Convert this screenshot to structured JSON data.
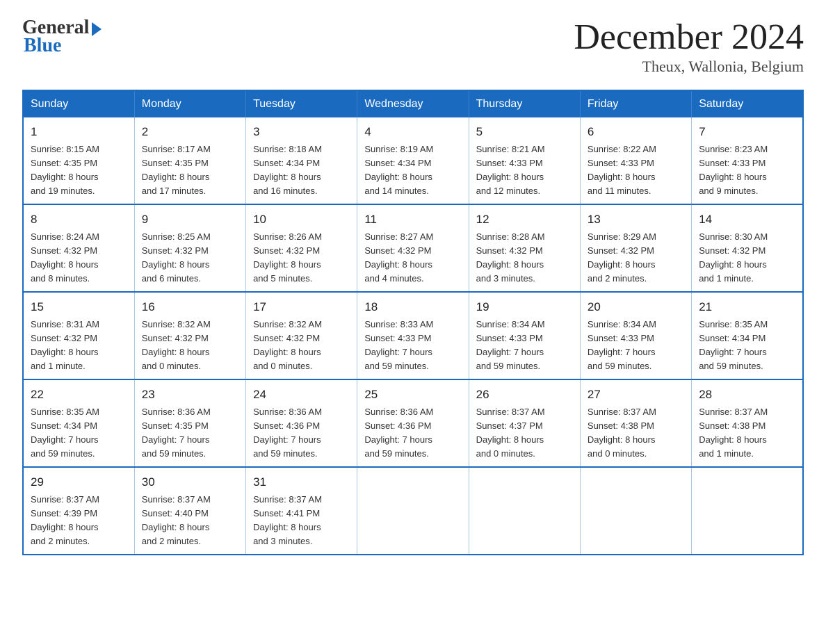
{
  "header": {
    "logo_general": "General",
    "logo_blue": "Blue",
    "month_title": "December 2024",
    "subtitle": "Theux, Wallonia, Belgium"
  },
  "days_of_week": [
    "Sunday",
    "Monday",
    "Tuesday",
    "Wednesday",
    "Thursday",
    "Friday",
    "Saturday"
  ],
  "weeks": [
    [
      {
        "day": "1",
        "info": "Sunrise: 8:15 AM\nSunset: 4:35 PM\nDaylight: 8 hours\nand 19 minutes."
      },
      {
        "day": "2",
        "info": "Sunrise: 8:17 AM\nSunset: 4:35 PM\nDaylight: 8 hours\nand 17 minutes."
      },
      {
        "day": "3",
        "info": "Sunrise: 8:18 AM\nSunset: 4:34 PM\nDaylight: 8 hours\nand 16 minutes."
      },
      {
        "day": "4",
        "info": "Sunrise: 8:19 AM\nSunset: 4:34 PM\nDaylight: 8 hours\nand 14 minutes."
      },
      {
        "day": "5",
        "info": "Sunrise: 8:21 AM\nSunset: 4:33 PM\nDaylight: 8 hours\nand 12 minutes."
      },
      {
        "day": "6",
        "info": "Sunrise: 8:22 AM\nSunset: 4:33 PM\nDaylight: 8 hours\nand 11 minutes."
      },
      {
        "day": "7",
        "info": "Sunrise: 8:23 AM\nSunset: 4:33 PM\nDaylight: 8 hours\nand 9 minutes."
      }
    ],
    [
      {
        "day": "8",
        "info": "Sunrise: 8:24 AM\nSunset: 4:32 PM\nDaylight: 8 hours\nand 8 minutes."
      },
      {
        "day": "9",
        "info": "Sunrise: 8:25 AM\nSunset: 4:32 PM\nDaylight: 8 hours\nand 6 minutes."
      },
      {
        "day": "10",
        "info": "Sunrise: 8:26 AM\nSunset: 4:32 PM\nDaylight: 8 hours\nand 5 minutes."
      },
      {
        "day": "11",
        "info": "Sunrise: 8:27 AM\nSunset: 4:32 PM\nDaylight: 8 hours\nand 4 minutes."
      },
      {
        "day": "12",
        "info": "Sunrise: 8:28 AM\nSunset: 4:32 PM\nDaylight: 8 hours\nand 3 minutes."
      },
      {
        "day": "13",
        "info": "Sunrise: 8:29 AM\nSunset: 4:32 PM\nDaylight: 8 hours\nand 2 minutes."
      },
      {
        "day": "14",
        "info": "Sunrise: 8:30 AM\nSunset: 4:32 PM\nDaylight: 8 hours\nand 1 minute."
      }
    ],
    [
      {
        "day": "15",
        "info": "Sunrise: 8:31 AM\nSunset: 4:32 PM\nDaylight: 8 hours\nand 1 minute."
      },
      {
        "day": "16",
        "info": "Sunrise: 8:32 AM\nSunset: 4:32 PM\nDaylight: 8 hours\nand 0 minutes."
      },
      {
        "day": "17",
        "info": "Sunrise: 8:32 AM\nSunset: 4:32 PM\nDaylight: 8 hours\nand 0 minutes."
      },
      {
        "day": "18",
        "info": "Sunrise: 8:33 AM\nSunset: 4:33 PM\nDaylight: 7 hours\nand 59 minutes."
      },
      {
        "day": "19",
        "info": "Sunrise: 8:34 AM\nSunset: 4:33 PM\nDaylight: 7 hours\nand 59 minutes."
      },
      {
        "day": "20",
        "info": "Sunrise: 8:34 AM\nSunset: 4:33 PM\nDaylight: 7 hours\nand 59 minutes."
      },
      {
        "day": "21",
        "info": "Sunrise: 8:35 AM\nSunset: 4:34 PM\nDaylight: 7 hours\nand 59 minutes."
      }
    ],
    [
      {
        "day": "22",
        "info": "Sunrise: 8:35 AM\nSunset: 4:34 PM\nDaylight: 7 hours\nand 59 minutes."
      },
      {
        "day": "23",
        "info": "Sunrise: 8:36 AM\nSunset: 4:35 PM\nDaylight: 7 hours\nand 59 minutes."
      },
      {
        "day": "24",
        "info": "Sunrise: 8:36 AM\nSunset: 4:36 PM\nDaylight: 7 hours\nand 59 minutes."
      },
      {
        "day": "25",
        "info": "Sunrise: 8:36 AM\nSunset: 4:36 PM\nDaylight: 7 hours\nand 59 minutes."
      },
      {
        "day": "26",
        "info": "Sunrise: 8:37 AM\nSunset: 4:37 PM\nDaylight: 8 hours\nand 0 minutes."
      },
      {
        "day": "27",
        "info": "Sunrise: 8:37 AM\nSunset: 4:38 PM\nDaylight: 8 hours\nand 0 minutes."
      },
      {
        "day": "28",
        "info": "Sunrise: 8:37 AM\nSunset: 4:38 PM\nDaylight: 8 hours\nand 1 minute."
      }
    ],
    [
      {
        "day": "29",
        "info": "Sunrise: 8:37 AM\nSunset: 4:39 PM\nDaylight: 8 hours\nand 2 minutes."
      },
      {
        "day": "30",
        "info": "Sunrise: 8:37 AM\nSunset: 4:40 PM\nDaylight: 8 hours\nand 2 minutes."
      },
      {
        "day": "31",
        "info": "Sunrise: 8:37 AM\nSunset: 4:41 PM\nDaylight: 8 hours\nand 3 minutes."
      },
      {
        "day": "",
        "info": ""
      },
      {
        "day": "",
        "info": ""
      },
      {
        "day": "",
        "info": ""
      },
      {
        "day": "",
        "info": ""
      }
    ]
  ]
}
